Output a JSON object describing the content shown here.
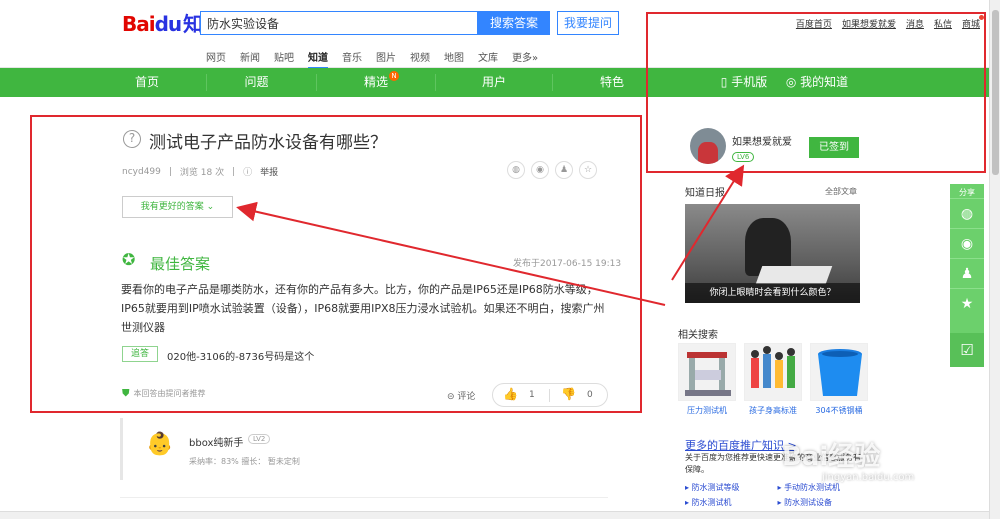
{
  "header": {
    "logo_bai": "Bai",
    "logo_du": "du",
    "logo_zhidao": "知道",
    "search_value": "防水实验设备",
    "search_button": "搜索答案",
    "ask_button": "我要提问",
    "top_links": [
      "百度首页",
      "如果想爱就爱",
      "消息",
      "私信",
      "商城"
    ]
  },
  "subnav": {
    "items": [
      "网页",
      "新闻",
      "贴吧",
      "知道",
      "音乐",
      "图片",
      "视频",
      "地图",
      "文库",
      "更多»"
    ],
    "active": "知道"
  },
  "greennav": {
    "items": [
      "首页",
      "问题",
      "精选",
      "用户",
      "特色"
    ],
    "badge": "N",
    "right_items": [
      "手机版",
      "我的知道"
    ]
  },
  "question": {
    "title": "测试电子产品防水设备有哪些？",
    "author": "ncyd499",
    "views": "浏览 18 次",
    "report": "举报",
    "better_answer_button": "我有更好的答案"
  },
  "best_answer": {
    "label": "最佳答案",
    "date": "发布于2017-06-15 19:13",
    "text": "要看你的电子产品是哪类防水，还有你的产品有多大。比方，你的产品是IP65还是IP68防水等级，IP65就要用到IP喷水试验装置（设备），IP68就要用IPX8压力浸水试验机。如果还不明白，搜索广州世测仪器",
    "follow_tag": "追答",
    "follow_text": "020他-3106的-8736号码是这个",
    "recommend": "本回答由提问者推荐",
    "comment": "评论",
    "up_count": "1",
    "down_count": "0"
  },
  "answerer": {
    "name": "bbox纯新手",
    "level": "LV2",
    "stats": "采纳率：83%    擅长：  暂未定制"
  },
  "sidebar": {
    "user_name": "如果想爱就爱",
    "user_level": "LV6",
    "signed_button": "已签到",
    "daily_title": "知道日报",
    "daily_all": "全部文章",
    "daily_caption": "你闭上眼睛时会看到什么颜色？",
    "related_title": "相关搜索",
    "related": [
      "压力测试机",
      "孩子身高标准",
      "304不锈钢桶"
    ],
    "promo_title": "更多的百度推广知识 >",
    "promo_desc": "关于百度为您推荐更快速更准确的商业信息服务有保障。",
    "promo_links": [
      "防水测试等级",
      "手动防水测试机",
      "防水测试机",
      "防水测试设备"
    ]
  },
  "side_share": {
    "label": "分享"
  },
  "watermark": {
    "main": "Bai经验",
    "sub": "jingyan.baidu.com"
  },
  "annotation_color": "#e0282e",
  "accent_green": "#40b640",
  "accent_blue": "#3385ff"
}
